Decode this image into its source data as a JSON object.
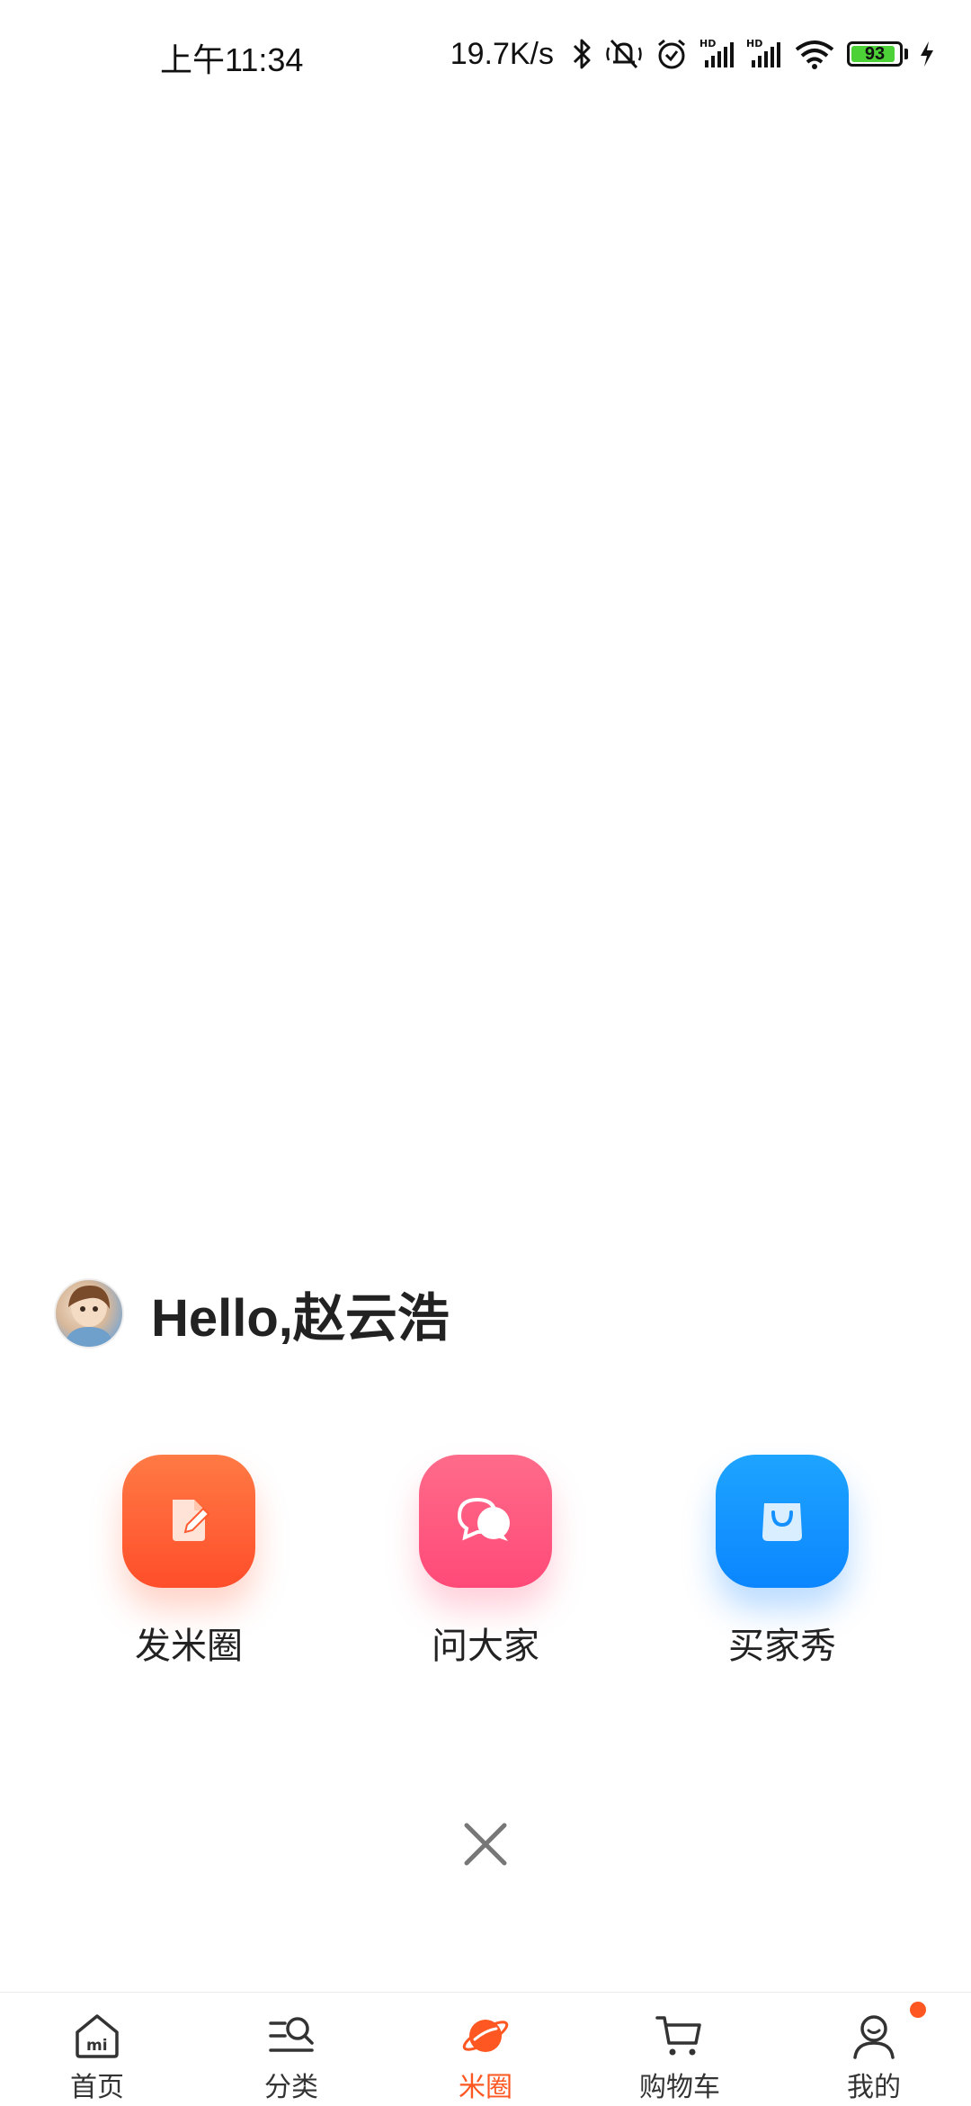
{
  "status_bar": {
    "time": "上午11:34",
    "net_speed": "19.7K/s",
    "battery_level": "93",
    "battery_fraction": 0.93,
    "icons": [
      "bluetooth-icon",
      "mute-vibrate-icon",
      "alarm-icon",
      "hd-signal-icon",
      "hd-signal-icon",
      "wifi-icon",
      "battery-icon",
      "charging-icon"
    ]
  },
  "greeting": {
    "text": "Hello,赵云浩"
  },
  "actions": [
    {
      "label": "发米圈",
      "icon": "note-edit-icon",
      "color": "#ff5a30"
    },
    {
      "label": "问大家",
      "icon": "chat-bubbles-icon",
      "color": "#ff5a80"
    },
    {
      "label": "买家秀",
      "icon": "shopping-bag-icon",
      "color": "#1591ff"
    }
  ],
  "close": {
    "icon": "close-icon"
  },
  "bottom_nav": {
    "items": [
      {
        "label": "首页",
        "icon": "home-mi-icon",
        "active": false
      },
      {
        "label": "分类",
        "icon": "category-search-icon",
        "active": false
      },
      {
        "label": "米圈",
        "icon": "planet-icon",
        "active": true
      },
      {
        "label": "购物车",
        "icon": "cart-icon",
        "active": false
      },
      {
        "label": "我的",
        "icon": "profile-icon",
        "active": false,
        "badge": true
      }
    ],
    "accent_color": "#ff5722"
  }
}
